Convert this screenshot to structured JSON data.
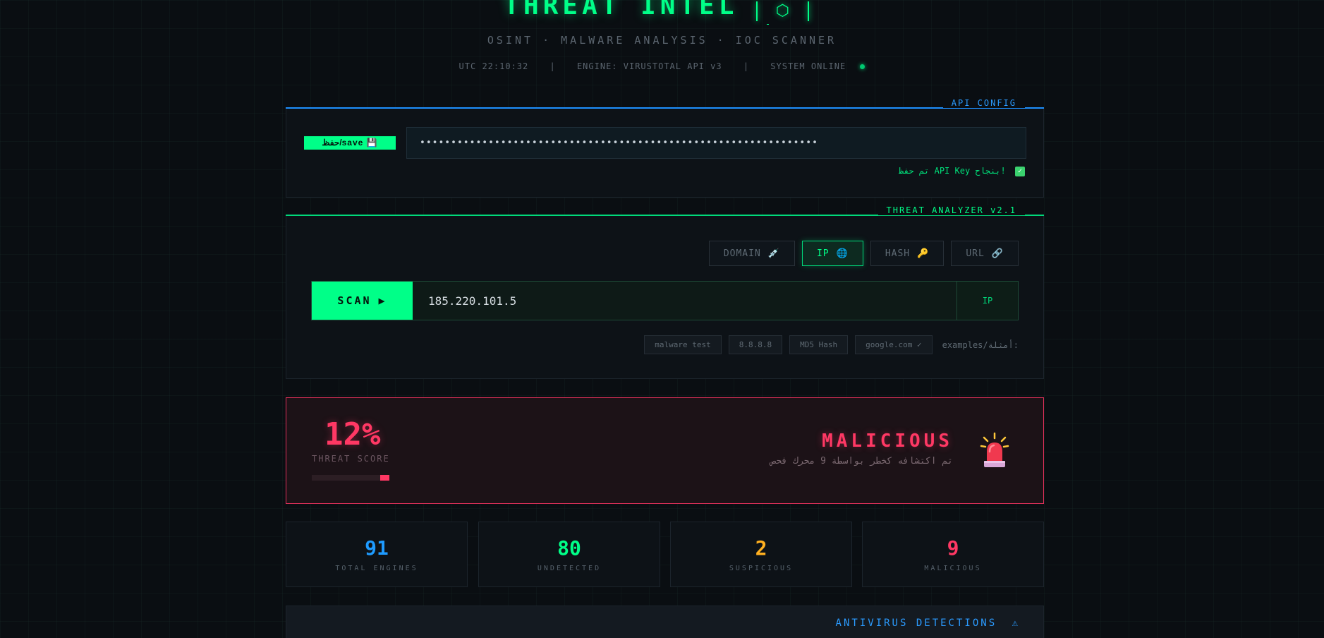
{
  "header": {
    "title": "THREAT INTEL",
    "title_icon": "⬡",
    "subtitle": "OSINT · MALWARE ANALYSIS · IOC SCANNER",
    "utc_time": "UTC 22:10:32",
    "separator": "|",
    "engine": "ENGINE: VIRUSTOTAL API v3",
    "system_status": "SYSTEM ONLINE"
  },
  "api_config": {
    "label": "API CONFIG",
    "save_label": "حفظ/save 💾",
    "key_value": "••••••••••••••••••••••••••••••••••••••••••••••••••••••••••••••••",
    "success_message": "تم حفظ API Key بنجاح!",
    "success_icon": "✓"
  },
  "analyzer": {
    "label": "THREAT ANALYZER v2.1",
    "tabs": [
      {
        "label": "DOMAIN",
        "icon": "💉",
        "active": false
      },
      {
        "label": "IP",
        "icon": "🌐",
        "active": true
      },
      {
        "label": "HASH",
        "icon": "🔑",
        "active": false
      },
      {
        "label": "URL",
        "icon": "🔗",
        "active": false
      }
    ],
    "scan_label": "SCAN",
    "scan_icon": "▶",
    "query_value": "185.220.101.5",
    "detected_type": "IP",
    "examples_label": "examples/أمثلة:",
    "examples": [
      "malware test",
      "8.8.8.8",
      "MD5 Hash",
      "google.com ✓"
    ]
  },
  "result": {
    "score": "12%",
    "score_fraction": 0.12,
    "score_label": "THREAT SCORE",
    "verdict": "MALICIOUS",
    "description": "تم اكتشافه كخطر بواسطة 9 محرك فحص",
    "icon": "siren-icon"
  },
  "stats": [
    {
      "value": "91",
      "label": "TOTAL ENGINES",
      "color": "#1e9bff"
    },
    {
      "value": "80",
      "label": "UNDETECTED",
      "color": "#00ff88"
    },
    {
      "value": "2",
      "label": "SUSPICIOUS",
      "color": "#ffb020"
    },
    {
      "value": "9",
      "label": "MALICIOUS",
      "color": "#ff3864"
    }
  ],
  "detections": {
    "title": "ANTIVIRUS DETECTIONS",
    "icon": "⚠"
  }
}
